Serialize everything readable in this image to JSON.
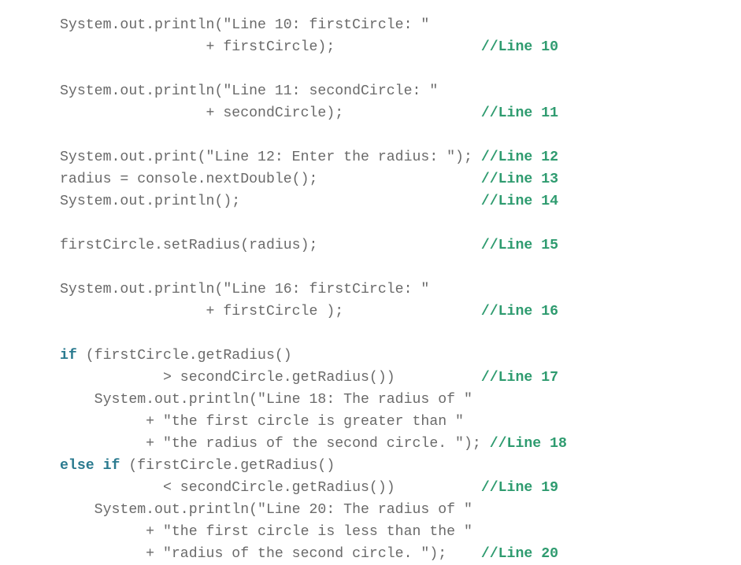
{
  "code": {
    "l1": "System.out.println(\"Line 10: firstCircle: \"",
    "l2a": "                 + firstCircle);                 ",
    "l2c": "//Line 10",
    "l3": "",
    "l4": "System.out.println(\"Line 11: secondCircle: \"",
    "l5a": "                 + secondCircle);                ",
    "l5c": "//Line 11",
    "l6": "",
    "l7a": "System.out.print(\"Line 12: Enter the radius: \"); ",
    "l7c": "//Line 12",
    "l8a": "radius = console.nextDouble();                   ",
    "l8c": "//Line 13",
    "l9a": "System.out.println();                            ",
    "l9c": "//Line 14",
    "l10": "",
    "l11a": "firstCircle.setRadius(radius);                   ",
    "l11c": "//Line 15",
    "l12": "",
    "l13": "System.out.println(\"Line 16: firstCircle: \"",
    "l14a": "                 + firstCircle );                ",
    "l14c": "//Line 16",
    "l15": "",
    "l16k": "if",
    "l16a": " (firstCircle.getRadius()",
    "l17a": "            > secondCircle.getRadius())          ",
    "l17c": "//Line 17",
    "l18": "    System.out.println(\"Line 18: The radius of \"",
    "l19": "          + \"the first circle is greater than \"",
    "l20a": "          + \"the radius of the second circle. \"); ",
    "l20c": "//Line 18",
    "l21k": "else if",
    "l21a": " (firstCircle.getRadius()",
    "l22a": "            < secondCircle.getRadius())          ",
    "l22c": "//Line 19",
    "l23": "    System.out.println(\"Line 20: The radius of \"",
    "l24": "          + \"the first circle is less than the \"",
    "l25a": "          + \"radius of the second circle. \");    ",
    "l25c": "//Line 20"
  }
}
